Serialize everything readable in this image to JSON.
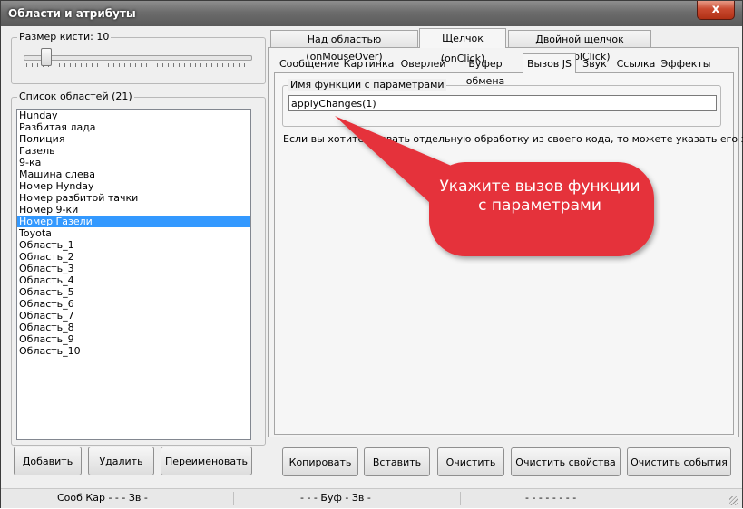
{
  "window": {
    "title": "Области и атрибуты",
    "close_label": "x"
  },
  "brush": {
    "legend": "Размер кисти:",
    "value": "10"
  },
  "area_list": {
    "legend": "Список областей (21)",
    "items": [
      "Hunday",
      "Разбитая лада",
      "Полиция",
      "Газель",
      "9-ка",
      "Машина слева",
      "Номер Hynday",
      "Номер разбитой тачки",
      "Номер 9-ки",
      "Номер Газели",
      "Toyota",
      "Область_1",
      "Область_2",
      "Область_3",
      "Область_4",
      "Область_5",
      "Область_6",
      "Область_7",
      "Область_8",
      "Область_9",
      "Область_10"
    ],
    "selected_index": 9
  },
  "left_buttons": {
    "add": "Добавить",
    "delete": "Удалить",
    "rename": "Переименовать"
  },
  "outer_tabs": [
    "Над областью (onMouseOver)",
    "Щелчок (onClick)",
    "Двойной щелчок (onDblClick)"
  ],
  "outer_active": 1,
  "inner_tabs": [
    "Сообщение",
    "Картинка",
    "Оверлей",
    "Буфер обмена",
    "Вызов JS",
    "Звук",
    "Ссылка",
    "Эффекты"
  ],
  "inner_active": 4,
  "js_call": {
    "legend": "Имя функции с параметрами",
    "value": "applyChanges(1)",
    "hint": "Если вы хотите вызвать отдельную обработку из своего кода, то можете указать его здесь."
  },
  "callout": {
    "text": "Укажите вызов функции с параметрами",
    "color": "#e5323b"
  },
  "right_buttons": {
    "copy": "Копировать",
    "paste": "Вставить",
    "clear": "Очистить",
    "clear_props": "Очистить свойства",
    "clear_events": "Очистить события"
  },
  "status": {
    "left": "Сооб Кар - - - Зв -",
    "middle": "- - - Буф - Зв -",
    "right": "- - - - - - - -"
  }
}
